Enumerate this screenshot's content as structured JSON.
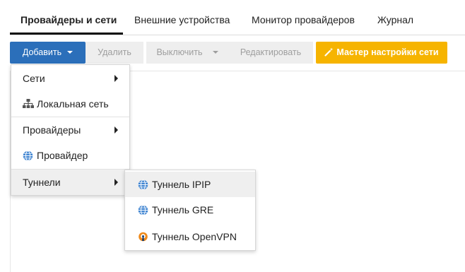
{
  "tabs": [
    {
      "label": "Провайдеры и сети",
      "active": true
    },
    {
      "label": "Внешние устройства"
    },
    {
      "label": "Монитор провайдеров"
    },
    {
      "label": "Журнал"
    }
  ],
  "toolbar": {
    "add_label": "Добавить",
    "delete_label": "Удалить",
    "disable_label": "Выключить",
    "edit_label": "Редактировать",
    "wizard_label": "Мастер настройки сети",
    "wizard_icon": "magic-wand-icon"
  },
  "menu": {
    "items": [
      {
        "label": "Сети",
        "has_submenu": true
      },
      {
        "label": "Локальная сеть",
        "icon": "network-hierarchy-icon"
      },
      {
        "label": "Провайдеры",
        "has_submenu": true
      },
      {
        "label": "Провайдер",
        "icon": "globe-icon"
      },
      {
        "label": "Туннели",
        "has_submenu": true,
        "highlighted": true
      }
    ]
  },
  "submenu": {
    "items": [
      {
        "label": "Туннель IPIP",
        "icon": "globe-icon",
        "highlighted": true
      },
      {
        "label": "Туннель GRE",
        "icon": "globe-icon"
      },
      {
        "label": "Туннель OpenVPN",
        "icon": "openvpn-icon"
      }
    ]
  },
  "colors": {
    "primary": "#2b6fba",
    "wizard": "#f6b400",
    "disabled_bg": "#eeeeee",
    "disabled_text": "#9e9e9e",
    "globe": "#3d83d1",
    "openvpn": "#ef8a1c"
  }
}
